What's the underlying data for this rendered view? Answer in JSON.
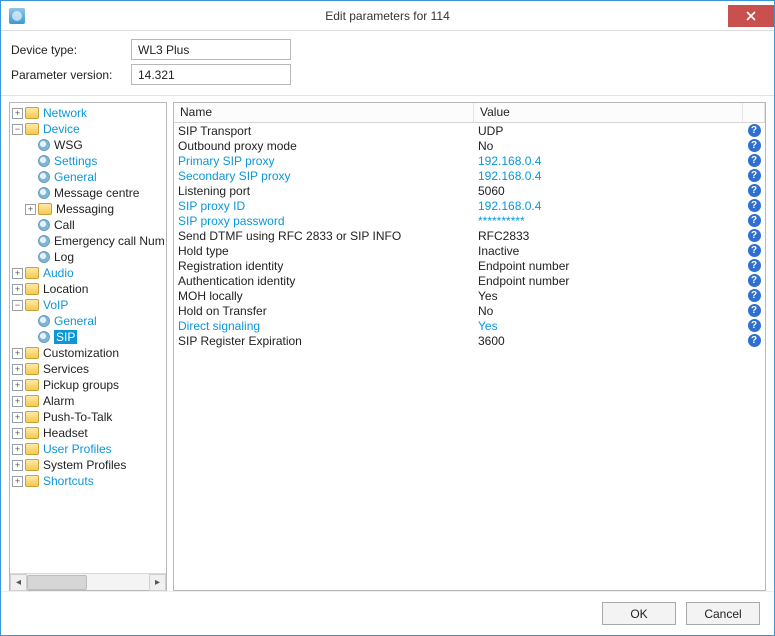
{
  "window": {
    "title": "Edit parameters for 114"
  },
  "header": {
    "deviceTypeLabel": "Device type:",
    "deviceType": "WL3 Plus",
    "paramVersionLabel": "Parameter version:",
    "paramVersion": "14.321"
  },
  "tree": [
    {
      "label": "Network",
      "style": "link",
      "icon": "folder",
      "exp": "+"
    },
    {
      "label": "Device",
      "style": "link",
      "icon": "folder",
      "exp": "-",
      "children": [
        {
          "label": "WSG",
          "style": "plain",
          "icon": "gear"
        },
        {
          "label": "Settings",
          "style": "link",
          "icon": "gear"
        },
        {
          "label": "General",
          "style": "link",
          "icon": "gear"
        },
        {
          "label": "Message centre",
          "style": "plain",
          "icon": "gear"
        },
        {
          "label": "Messaging",
          "style": "plain",
          "icon": "folder",
          "exp": "+"
        },
        {
          "label": "Call",
          "style": "plain",
          "icon": "gear"
        },
        {
          "label": "Emergency call Num",
          "style": "plain",
          "icon": "gear"
        },
        {
          "label": "Log",
          "style": "plain",
          "icon": "gear"
        }
      ]
    },
    {
      "label": "Audio",
      "style": "link",
      "icon": "folder",
      "exp": "+"
    },
    {
      "label": "Location",
      "style": "plain",
      "icon": "folder",
      "exp": "+"
    },
    {
      "label": "VoIP",
      "style": "link",
      "icon": "folder",
      "exp": "-",
      "children": [
        {
          "label": "General",
          "style": "link",
          "icon": "gear"
        },
        {
          "label": "SIP",
          "style": "link",
          "icon": "gear",
          "selected": true
        }
      ]
    },
    {
      "label": "Customization",
      "style": "plain",
      "icon": "folder",
      "exp": "+"
    },
    {
      "label": "Services",
      "style": "plain",
      "icon": "folder",
      "exp": "+"
    },
    {
      "label": "Pickup groups",
      "style": "plain",
      "icon": "folder",
      "exp": "+"
    },
    {
      "label": "Alarm",
      "style": "plain",
      "icon": "folder",
      "exp": "+"
    },
    {
      "label": "Push-To-Talk",
      "style": "plain",
      "icon": "folder",
      "exp": "+"
    },
    {
      "label": "Headset",
      "style": "plain",
      "icon": "folder",
      "exp": "+"
    },
    {
      "label": "User Profiles",
      "style": "link",
      "icon": "folder",
      "exp": "+"
    },
    {
      "label": "System Profiles",
      "style": "plain",
      "icon": "folder",
      "exp": "+"
    },
    {
      "label": "Shortcuts",
      "style": "link",
      "icon": "folder",
      "exp": "+"
    }
  ],
  "grid": {
    "colName": "Name",
    "colValue": "Value",
    "rows": [
      {
        "name": "SIP Transport",
        "value": "UDP"
      },
      {
        "name": "Outbound proxy mode",
        "value": "No"
      },
      {
        "name": "Primary SIP proxy",
        "value": "192.168.0.4",
        "link": true
      },
      {
        "name": "Secondary SIP proxy",
        "value": "192.168.0.4",
        "link": true
      },
      {
        "name": "Listening port",
        "value": "5060"
      },
      {
        "name": "SIP proxy ID",
        "value": "192.168.0.4",
        "link": true
      },
      {
        "name": "SIP proxy password",
        "value": "**********",
        "link": true
      },
      {
        "name": "Send DTMF using RFC 2833 or SIP INFO",
        "value": "RFC2833"
      },
      {
        "name": "Hold type",
        "value": "Inactive"
      },
      {
        "name": "Registration identity",
        "value": "Endpoint number"
      },
      {
        "name": "Authentication identity",
        "value": "Endpoint number"
      },
      {
        "name": "MOH locally",
        "value": "Yes"
      },
      {
        "name": "Hold on Transfer",
        "value": "No"
      },
      {
        "name": "Direct signaling",
        "value": "Yes",
        "link": true
      },
      {
        "name": "SIP Register Expiration",
        "value": "3600"
      }
    ]
  },
  "footer": {
    "ok": "OK",
    "cancel": "Cancel"
  }
}
